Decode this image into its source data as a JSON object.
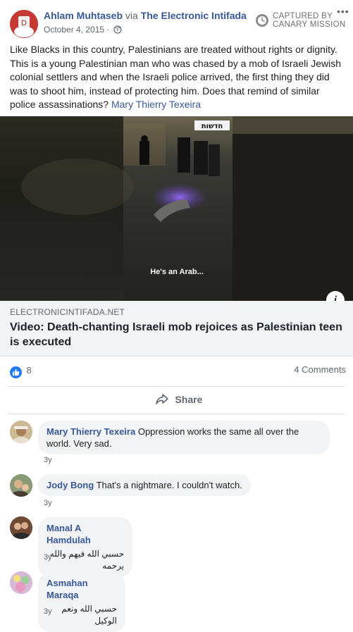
{
  "post": {
    "author": "Ahlam Muhtaseb",
    "via": "via",
    "page": "The Electronic Intifada",
    "date": "October 4, 2015 ·",
    "captured_line1": "CAPTURED BY",
    "captured_line2": "CANARY MISSION",
    "text": "Like Blacks in this country, Palestinians are treated without rights or dignity. This is a young Palestinian man who was chased by a mob of Israeli Jewish colonial settlers and when the Israeli police arrived, the first thing they did was to shoot him, instead of protecting him. Does that remind of similar police assassinations? ",
    "tagged": "Mary Thierry Texeira"
  },
  "video": {
    "caption": "He's an Arab...",
    "watermark": "חדשות"
  },
  "link": {
    "domain": "ELECTRONICINTIFADA.NET",
    "title": "Video: Death-chanting Israeli mob rejoices as Palestinian teen is executed"
  },
  "stats": {
    "likes": "8",
    "comments": "4 Comments"
  },
  "actions": {
    "share": "Share"
  },
  "comments": [
    {
      "name": "Mary Thierry Texeira",
      "text": "Oppression works the same all over the world. Very sad.",
      "time": "3y"
    },
    {
      "name": "Jody Bong",
      "text": "That's a nightmare. I couldn't watch.",
      "time": "3y"
    },
    {
      "name": "Manal A Hamdulah",
      "text": "حسبي الله فيهم والله يرحمه",
      "time": "3y"
    },
    {
      "name": "Asmahan Maraqa",
      "text": "حسبي الله ونعم الوكيل",
      "time": "3y"
    }
  ],
  "colors": {
    "link_blue": "#385898",
    "like_blue": "#2078f4",
    "muted": "#606770"
  }
}
